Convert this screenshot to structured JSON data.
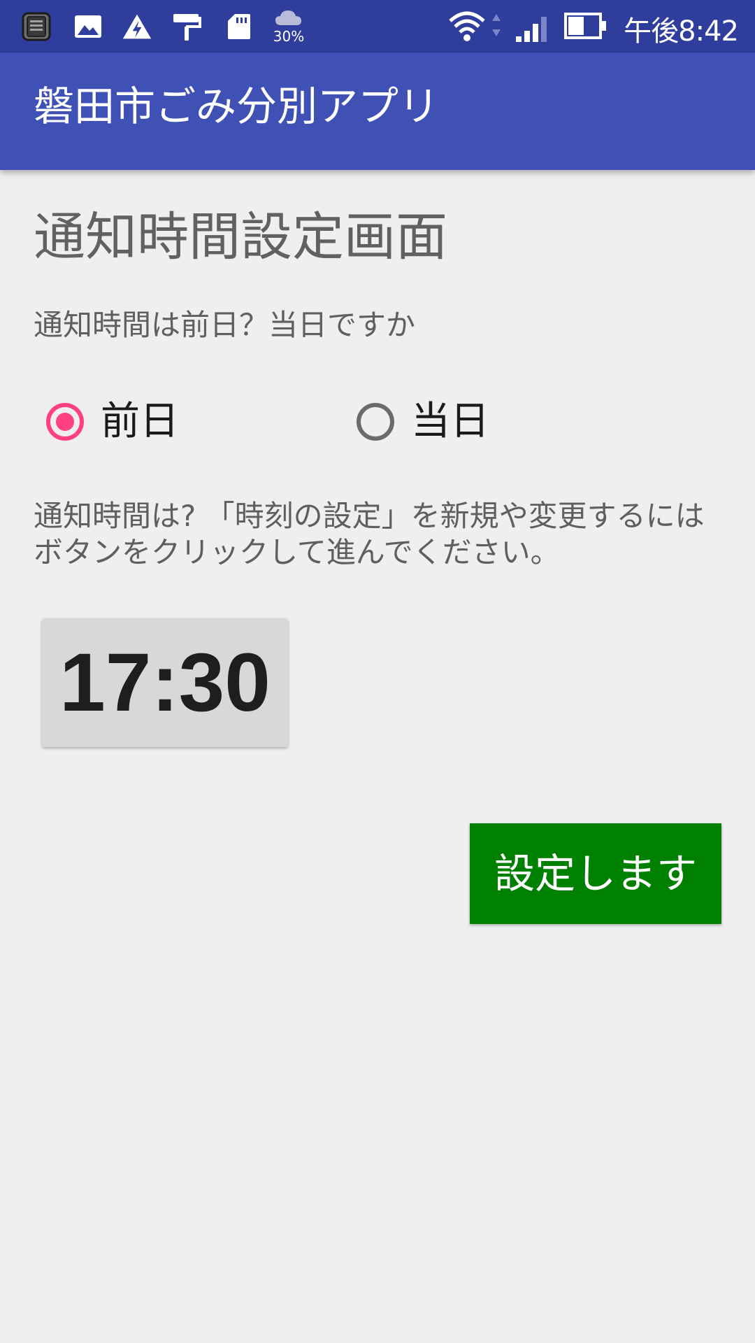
{
  "status_bar": {
    "time": "午後8:42",
    "weather_percent": "30%",
    "icons": [
      "notes-app-icon",
      "image-icon",
      "warning-icon",
      "paint-roller-icon",
      "sd-card-icon",
      "cloud-icon",
      "wifi-icon",
      "signal-icon",
      "battery-icon"
    ]
  },
  "app_bar": {
    "title": "磐田市ごみ分別アプリ"
  },
  "content": {
    "heading": "通知時間設定画面",
    "question": "通知時間は前日？当日ですか",
    "radio_options": [
      {
        "label": "前日",
        "checked": true
      },
      {
        "label": "当日",
        "checked": false
      }
    ],
    "instruction": "通知時間は? 「時刻の設定」を新規や変更するにはボタンをクリックして進んでください。",
    "time_button_label": "17:30",
    "submit_button_label": "設定します"
  },
  "colors": {
    "status_bar": "#2f3e9c",
    "app_bar": "#3f51b5",
    "background": "#efefef",
    "radio_accent": "#ff4081",
    "submit_button": "#008000",
    "time_button": "#d8d8d8"
  }
}
